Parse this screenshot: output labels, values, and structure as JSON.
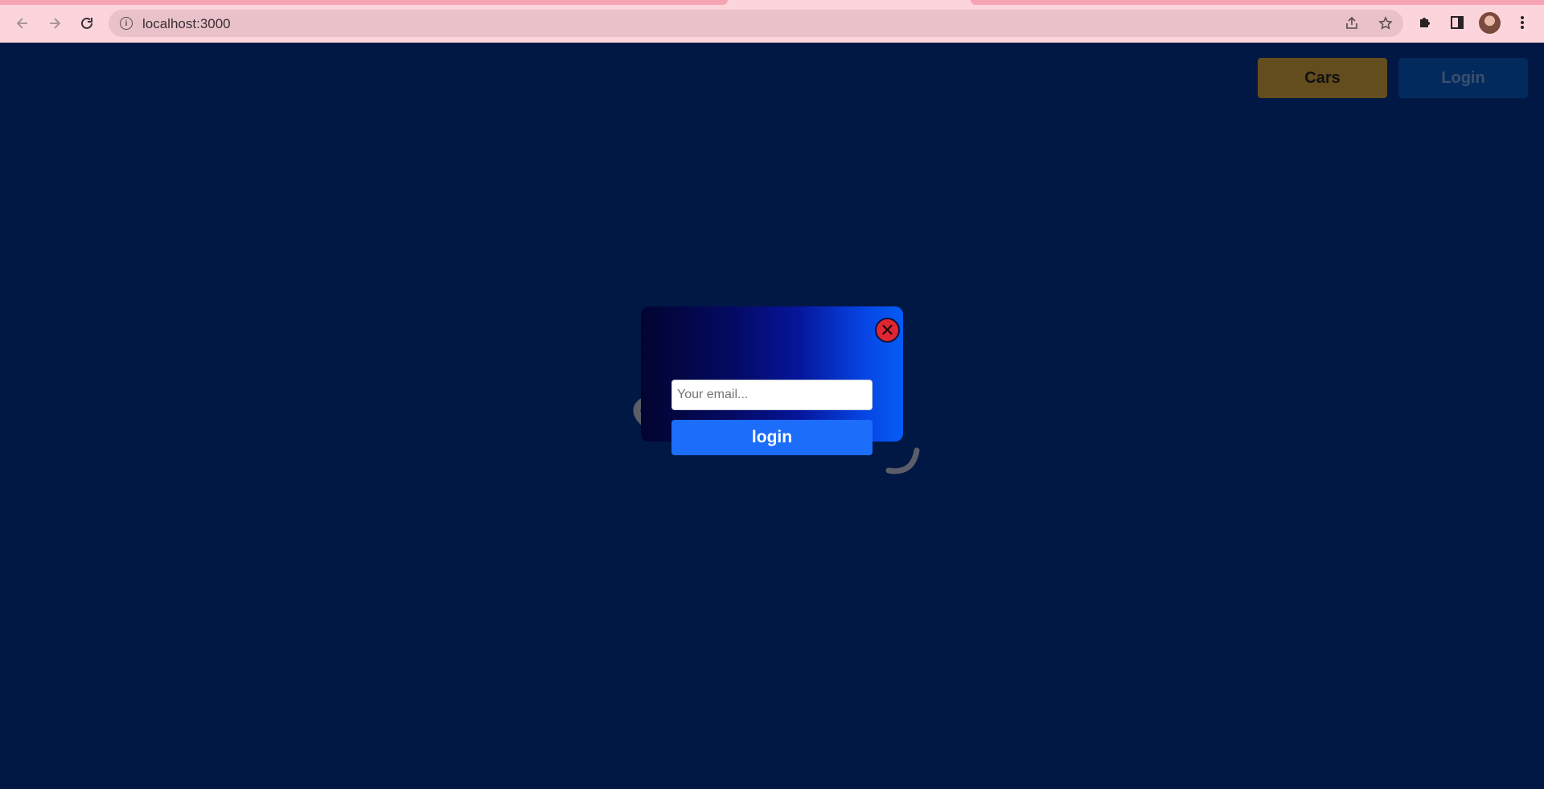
{
  "browser": {
    "url": "localhost:3000",
    "back_icon": "arrow-left-icon",
    "forward_icon": "arrow-right-icon",
    "reload_icon": "reload-icon"
  },
  "nav": {
    "cars_label": "Cars",
    "login_label": "Login"
  },
  "modal": {
    "close_symbol": "✕",
    "email_placeholder": "Your email...",
    "email_value": "",
    "submit_label": "login"
  },
  "colors": {
    "page_bg": "#011844",
    "cars_button": "#634c1d",
    "login_button": "#032a5d",
    "submit_button": "#1c6df9",
    "close_button": "#e02632"
  }
}
